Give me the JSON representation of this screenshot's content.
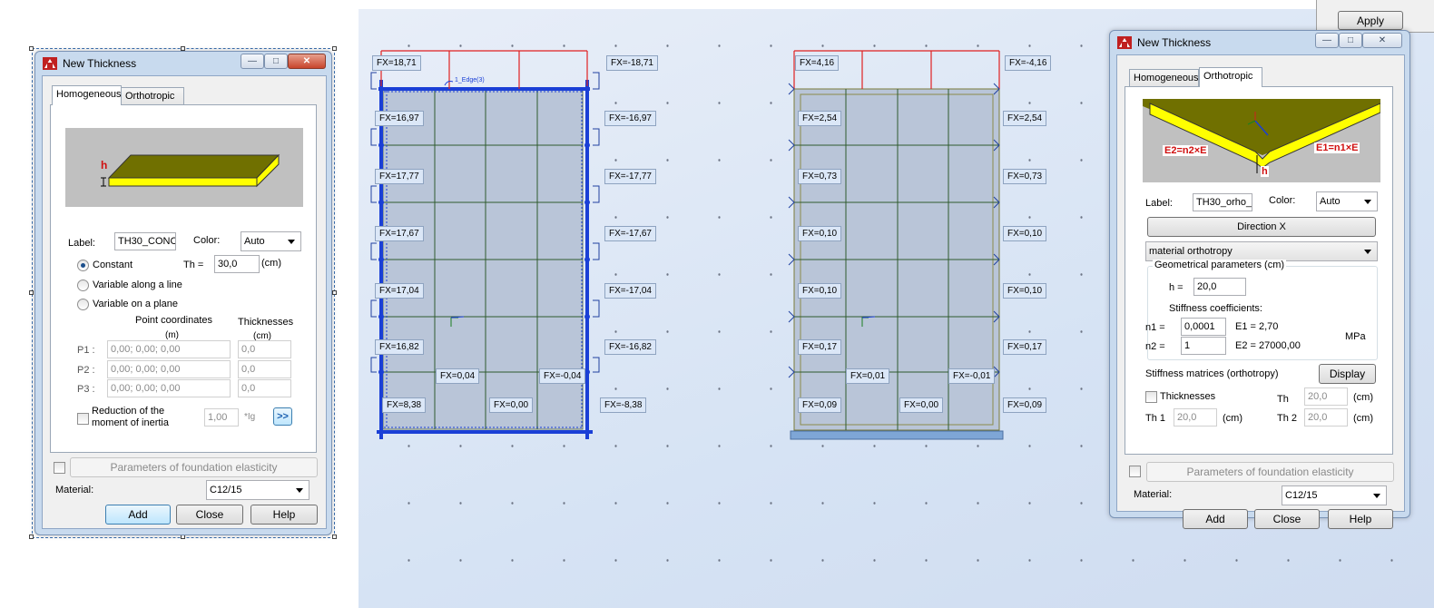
{
  "background_window": {
    "apply_label": "Apply"
  },
  "dialog1": {
    "title": "New Thickness",
    "tabs": [
      "Homogeneous",
      "Orthotropic"
    ],
    "active_tab": "Homogeneous",
    "picture_h": "h",
    "label_caption": "Label:",
    "label_value": "TH30_CONC",
    "color_caption": "Color:",
    "color_value": "Auto",
    "radios": [
      "Constant",
      "Variable along a line",
      "Variable on a plane"
    ],
    "th_caption": "Th =",
    "th_value": "30,0",
    "th_unit": "(cm)",
    "point_coords_header": "Point coordinates",
    "point_coords_unit": "(m)",
    "thickness_header": "Thicknesses",
    "thickness_unit": "(cm)",
    "points": [
      {
        "label": "P1 :",
        "coords": "0,00; 0,00; 0,00",
        "th": "0,0"
      },
      {
        "label": "P2 :",
        "coords": "0,00; 0,00; 0,00",
        "th": "0,0"
      },
      {
        "label": "P3 :",
        "coords": "0,00; 0,00; 0,00",
        "th": "0,0"
      }
    ],
    "reduction_label1": "Reduction of the",
    "reduction_label2": "moment of inertia",
    "reduction_value": "1,00",
    "reduction_unit": "*Ig",
    "more_button": ">>",
    "foundation_button": "Parameters of foundation elasticity",
    "material_caption": "Material:",
    "material_value": "C12/15",
    "add": "Add",
    "close": "Close",
    "help": "Help"
  },
  "dialog2": {
    "title": "New Thickness",
    "tabs": [
      "Homogeneous",
      "Orthotropic"
    ],
    "active_tab": "Orthotropic",
    "picture_e2": "E2=n2×E",
    "picture_e1": "E1=n1×E",
    "picture_h": "h",
    "label_caption": "Label:",
    "label_value": "TH30_orho_",
    "color_caption": "Color:",
    "color_value": "Auto",
    "direction_button": "Direction X",
    "orthotropy_value": "material orthotropy",
    "geom_group": "Geometrical parameters (cm)",
    "h_caption": "h  =",
    "h_value": "20,0",
    "stiffness_coeffs": "Stiffness coefficients:",
    "n1_caption": "n1  =",
    "n1_value": "0,0001",
    "e1_caption": "E1  =  2,70",
    "n2_caption": "n2  =",
    "n2_value": "1",
    "e2_caption": "E2  =  27000,00",
    "mpa": "MPa",
    "matrices_caption": "Stiffness matrices (orthotropy)",
    "display_button": "Display",
    "thicknesses_caption": "Thicknesses",
    "th_caption": "Th",
    "th_value": "20,0",
    "th_unit": "(cm)",
    "th1_caption": "Th 1",
    "th1_value": "20,0",
    "th1_unit": "(cm)",
    "th2_caption": "Th 2",
    "th2_value": "20,0",
    "th2_unit": "(cm)",
    "foundation_button": "Parameters of foundation elasticity",
    "material_caption": "Material:",
    "material_value": "C12/15",
    "add": "Add",
    "close": "Close",
    "help": "Help"
  },
  "model": {
    "edge_label": "1_Edge(3)",
    "left_wall_left_labels": [
      "FX=18,71",
      "FX=16,97",
      "FX=17,77",
      "FX=17,67",
      "FX=17,04",
      "FX=16,82",
      "FX=8,38"
    ],
    "left_wall_right_labels": [
      "FX=-18,71",
      "FX=-16,97",
      "FX=-17,77",
      "FX=-17,67",
      "FX=-17,04",
      "FX=-16,82",
      "FX=-8,38"
    ],
    "left_wall_inner_labels": [
      "FX=0,04",
      "FX=-0,04",
      "FX=0,00"
    ],
    "right_wall_left_labels": [
      "FX=4,16",
      "FX=2,54",
      "FX=0,73",
      "FX=0,10",
      "FX=0,10",
      "FX=0,17",
      "FX=0,09"
    ],
    "right_wall_right_labels": [
      "FX=-4,16",
      "FX=2,54",
      "FX=0,73",
      "FX=0,10",
      "FX=0,10",
      "FX=0,17",
      "FX=0,09"
    ],
    "right_wall_inner_labels": [
      "FX=0,01",
      "FX=-0,01",
      "FX=0,00"
    ],
    "colors": {
      "canvas": "#dbe6f6",
      "panel_fill": "#b9c5d8",
      "grid_lines": "#2e5a2e",
      "selection": "#1a3fd6",
      "loads": "#e02020"
    }
  }
}
